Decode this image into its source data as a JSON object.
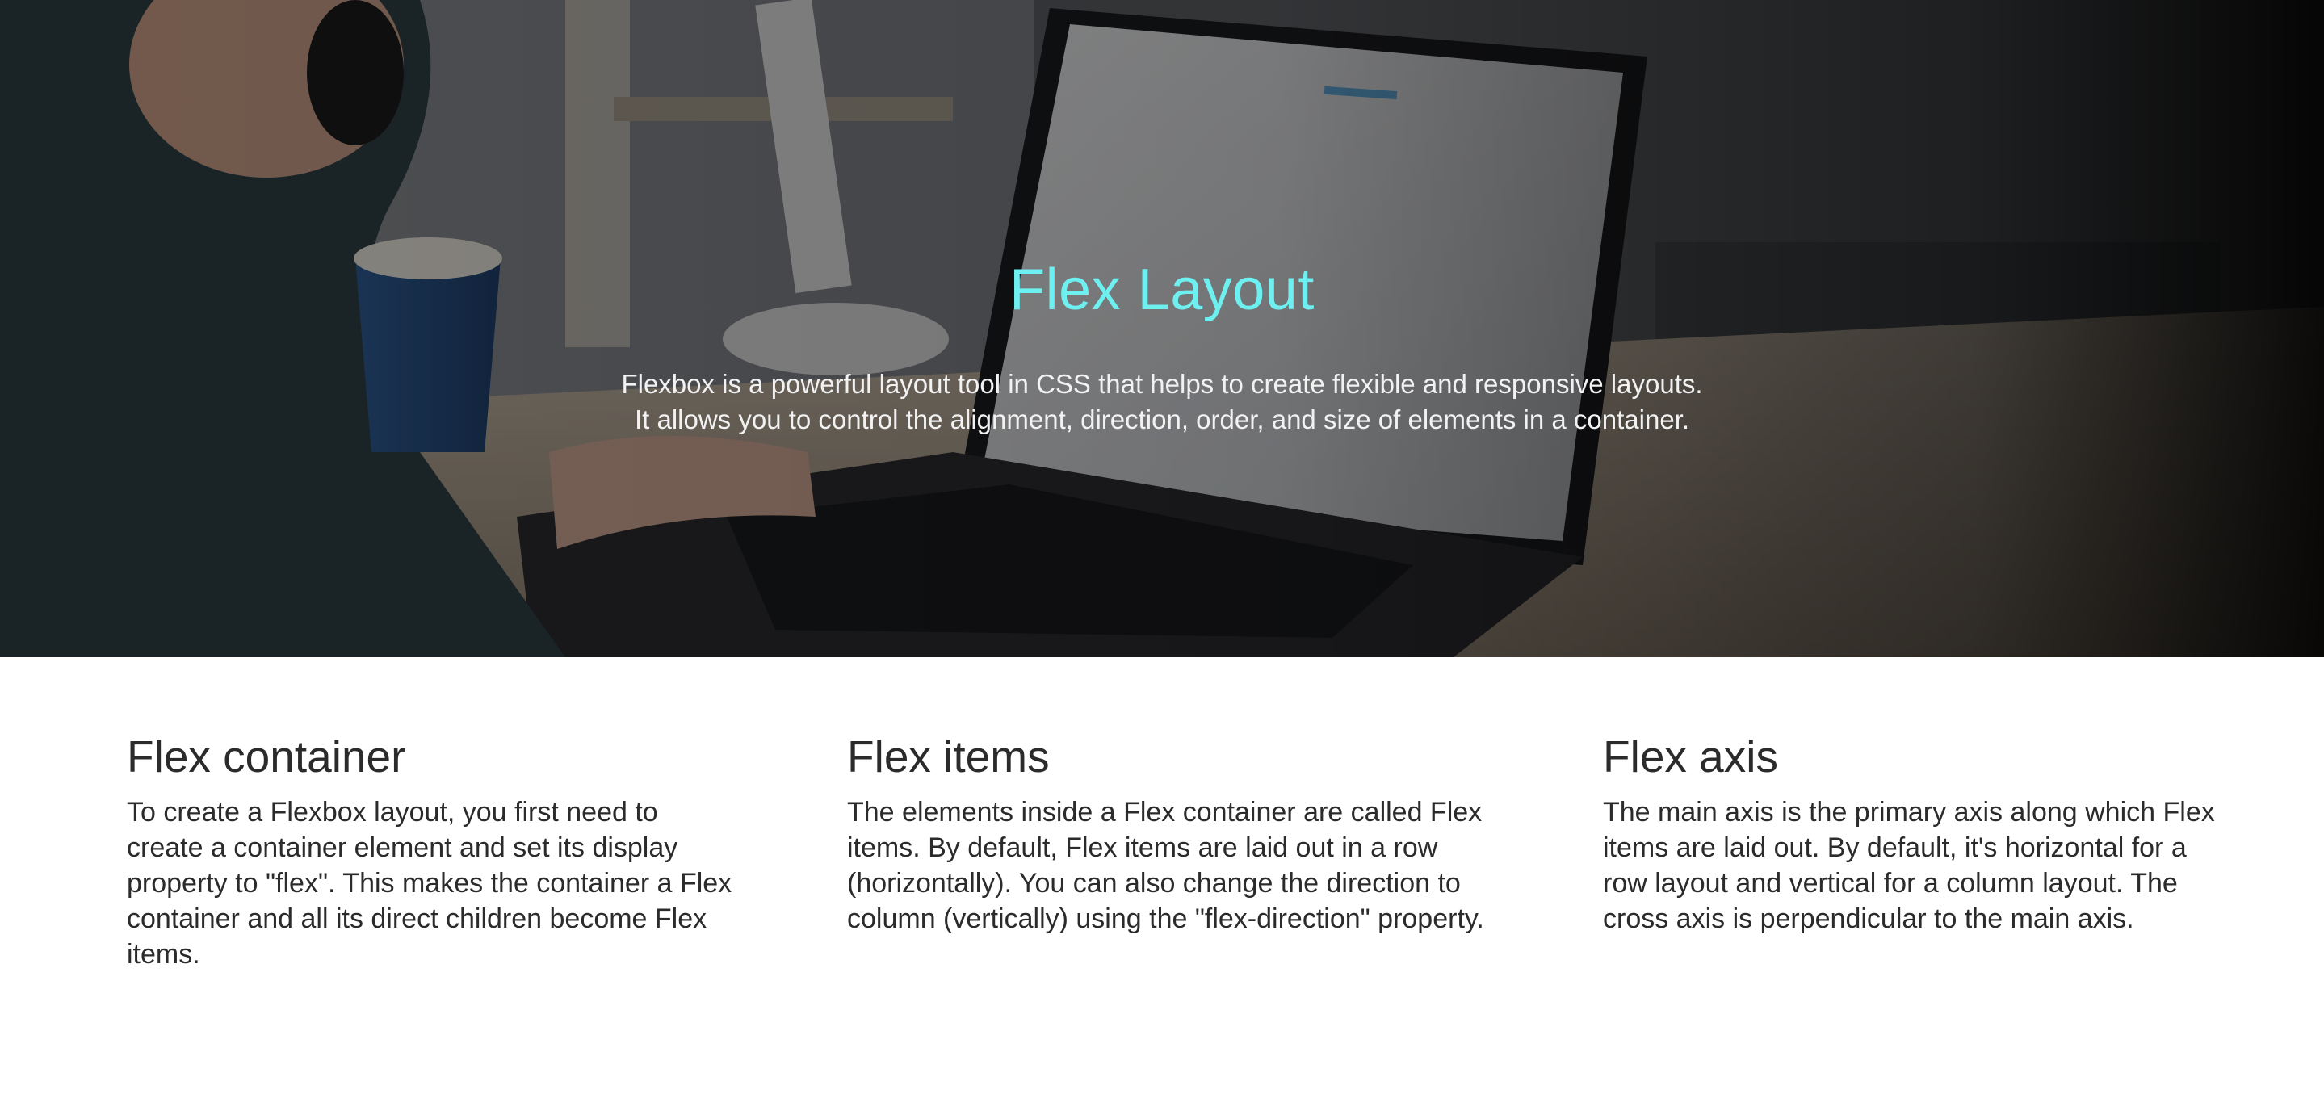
{
  "hero": {
    "title": "Flex Layout",
    "description_line1": "Flexbox is a powerful layout tool in CSS that helps to create flexible and responsive layouts.",
    "description_line2": "It allows you to control the alignment, direction, order, and size of elements in a container.",
    "title_color": "#6ff0f0",
    "text_color": "#f2f2f2"
  },
  "features": [
    {
      "heading": "Flex container",
      "text": "To create a Flexbox layout, you first need to create a container element and set its display property to \"flex\". This makes the container a Flex container and all its direct children become Flex items."
    },
    {
      "heading": "Flex items",
      "text": "The elements inside a Flex container are called Flex items. By default, Flex items are laid out in a row (horizontally). You can also change the direction to column (vertically) using the \"flex-direction\" property."
    },
    {
      "heading": "Flex axis",
      "text": "The main axis is the primary axis along which Flex items are laid out. By default, it's horizontal for a row layout and vertical for a column layout. The cross axis is perpendicular to the main axis."
    }
  ]
}
